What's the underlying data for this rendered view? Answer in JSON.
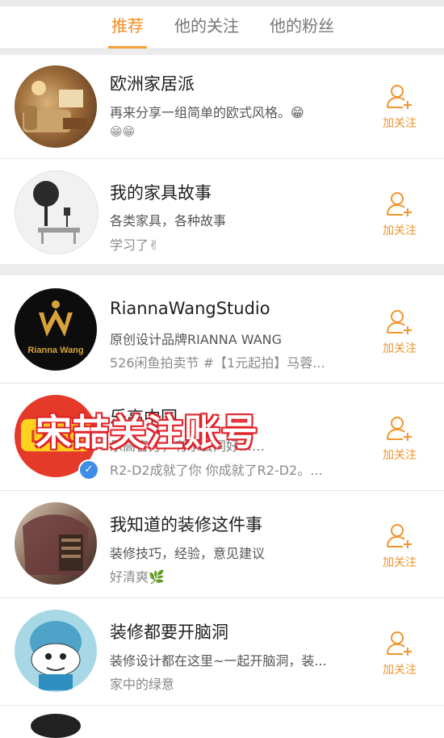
{
  "tabs": [
    {
      "label": "推荐",
      "active": true
    },
    {
      "label": "他的关注",
      "active": false
    },
    {
      "label": "他的粉丝",
      "active": false
    }
  ],
  "follow_label": "加关注",
  "accounts": [
    {
      "name": "欧洲家居派",
      "desc": "再来分享一组简单的欧式风格。😁",
      "sub": "😁😁"
    },
    {
      "name": "我的家具故事",
      "desc": "各类家具，各种故事",
      "sub": "学习了✌"
    },
    {
      "name": "RiannaWangStudio",
      "desc": "原创设计品牌RIANNA WANG",
      "sub": "526闲鱼拍卖节 #【1元起拍】马蓉...",
      "avatar_text": "Rianna Wang"
    },
    {
      "name": "乐高中国",
      "desc": "乐高官方，有乐云同好……",
      "sub": "R2-D2成就了你 你成就了R2-D2。...",
      "verified": true,
      "avatar_text": "LEGO"
    },
    {
      "name": "我知道的装修这件事",
      "desc": "装修技巧，经验，意见建议",
      "sub": "好清爽🌿"
    },
    {
      "name": "装修都要开脑洞",
      "desc": "装修设计都在这里~一起开脑洞，装...",
      "sub": "家中的绿意"
    }
  ],
  "overlay_text": "宋喆关注账号",
  "colors": {
    "accent": "#f28a22",
    "overlay": "#e0232a"
  }
}
